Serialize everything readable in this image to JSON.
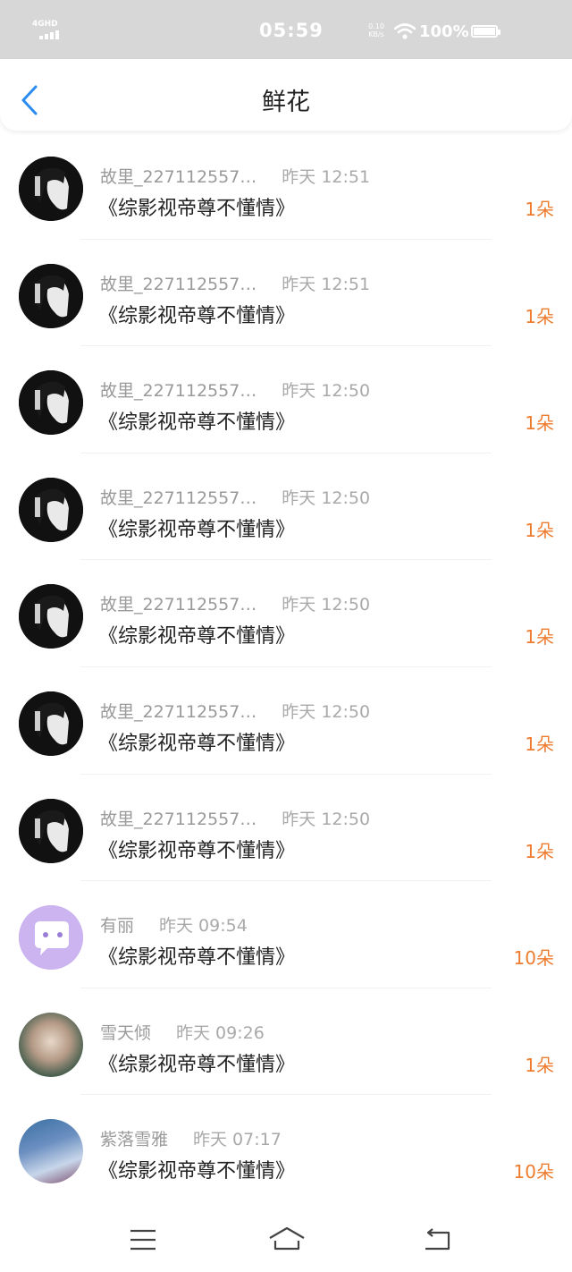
{
  "status_bar": {
    "network": "4GHD",
    "time": "05:59",
    "speed": "0.10 KB/s",
    "battery": "100%",
    "icons": [
      "signal-icon",
      "wifi-icon",
      "battery-icon"
    ]
  },
  "header": {
    "title": "鲜花",
    "back_icon": "back-chevron-icon"
  },
  "accent_colors": {
    "back_icon": "#2a8cf0",
    "count": "#ee7c2f"
  },
  "items": [
    {
      "user": "故里_227112557…",
      "time": "昨天 12:51",
      "book": "《综影视帝尊不懂情》",
      "count": "1朵"
    },
    {
      "user": "故里_227112557…",
      "time": "昨天 12:51",
      "book": "《综影视帝尊不懂情》",
      "count": "1朵"
    },
    {
      "user": "故里_227112557…",
      "time": "昨天 12:50",
      "book": "《综影视帝尊不懂情》",
      "count": "1朵"
    },
    {
      "user": "故里_227112557…",
      "time": "昨天 12:50",
      "book": "《综影视帝尊不懂情》",
      "count": "1朵"
    },
    {
      "user": "故里_227112557…",
      "time": "昨天 12:50",
      "book": "《综影视帝尊不懂情》",
      "count": "1朵"
    },
    {
      "user": "故里_227112557…",
      "time": "昨天 12:50",
      "book": "《综影视帝尊不懂情》",
      "count": "1朵"
    },
    {
      "user": "故里_227112557…",
      "time": "昨天 12:50",
      "book": "《综影视帝尊不懂情》",
      "count": "1朵"
    },
    {
      "user": "有丽",
      "time": "昨天 09:54",
      "book": "《综影视帝尊不懂情》",
      "count": "10朵"
    },
    {
      "user": "雪天倾",
      "time": "昨天 09:26",
      "book": "《综影视帝尊不懂情》",
      "count": "1朵"
    },
    {
      "user": "紫落雪雅",
      "time": "昨天 07:17",
      "book": "《综影视帝尊不懂情》",
      "count": "10朵"
    }
  ],
  "bottom_nav": [
    "menu-icon",
    "home-icon",
    "back-icon"
  ]
}
